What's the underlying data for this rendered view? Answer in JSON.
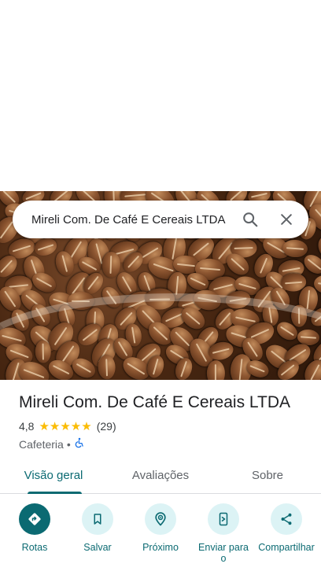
{
  "search": {
    "query": "Mireli Com. De Café E Cereais LTDA"
  },
  "place": {
    "title": "Mireli Com. De Café E Cereais LTDA",
    "rating_value": "4,8",
    "stars": "★★★★★",
    "review_count": "(29)",
    "category": "Cafeteria",
    "separator": "•"
  },
  "tabs": [
    {
      "label": "Visão geral",
      "active": true
    },
    {
      "label": "Avaliações",
      "active": false
    },
    {
      "label": "Sobre",
      "active": false
    }
  ],
  "actions": [
    {
      "label": "Rotas",
      "icon": "directions-icon"
    },
    {
      "label": "Salvar",
      "icon": "bookmark-icon"
    },
    {
      "label": "Próximo",
      "icon": "nearby-icon"
    },
    {
      "label": "Enviar para o",
      "icon": "send-to-phone-icon"
    },
    {
      "label": "Compartilhar",
      "icon": "share-icon"
    }
  ],
  "colors": {
    "accent": "#0b6a72",
    "action_bg": "#dcf3f5",
    "star": "#fbbc04"
  }
}
